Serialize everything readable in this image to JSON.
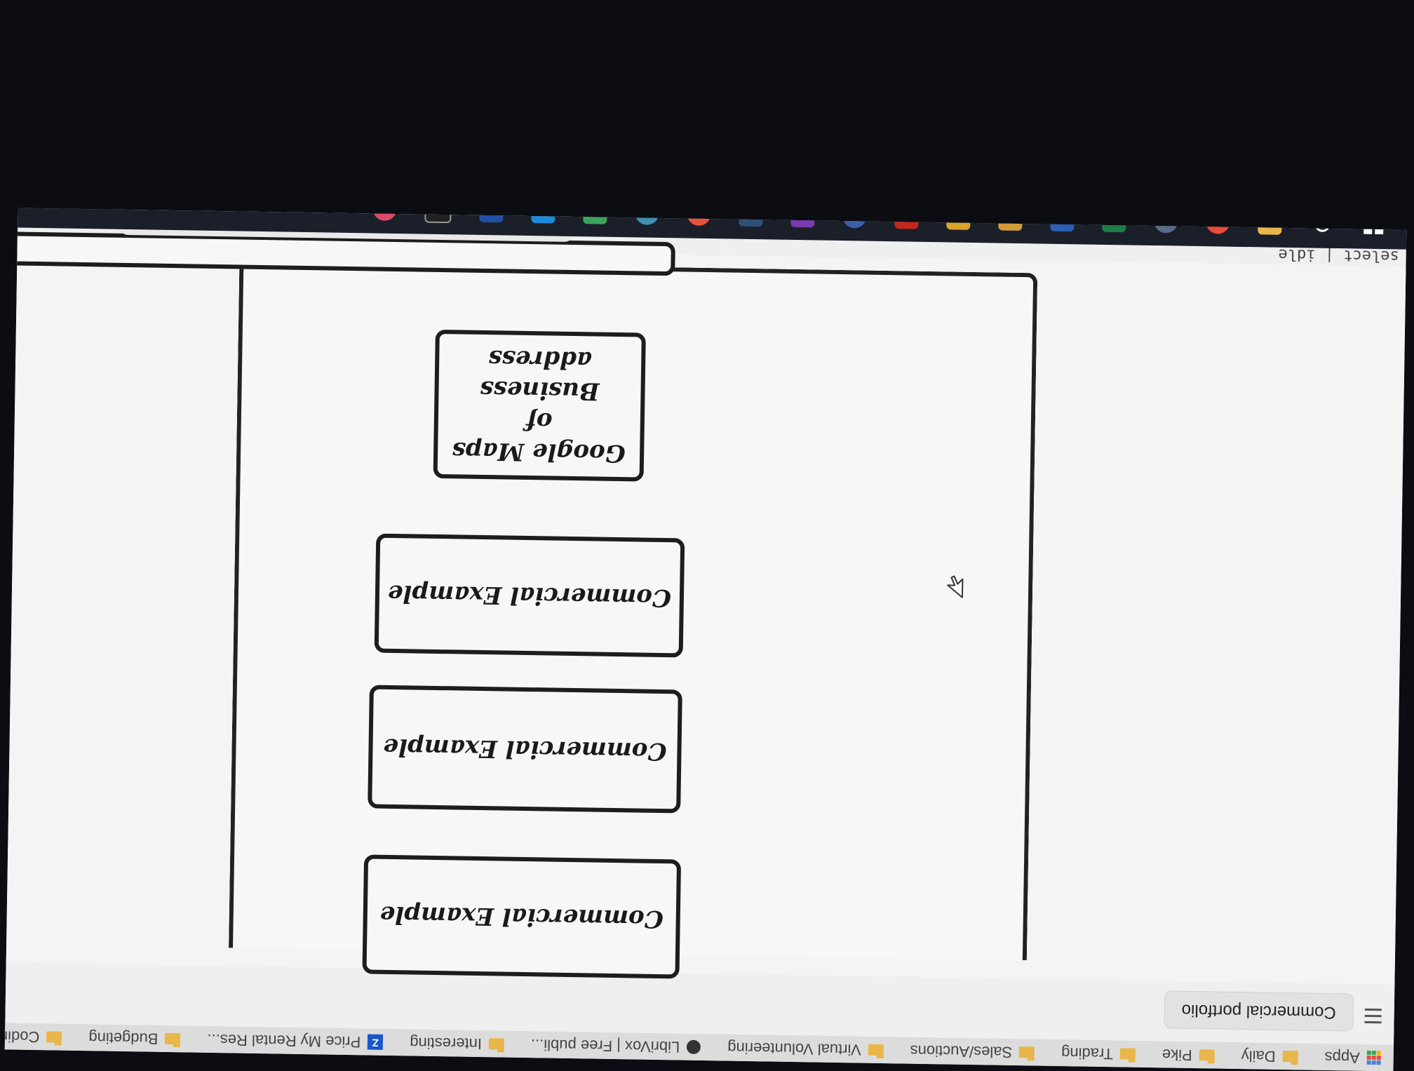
{
  "bookmarks": {
    "items": [
      {
        "label": "Apps",
        "icon": "apps-grid-icon"
      },
      {
        "label": "Daily",
        "icon": "folder-icon"
      },
      {
        "label": "Pike",
        "icon": "folder-icon"
      },
      {
        "label": "Trading",
        "icon": "folder-icon"
      },
      {
        "label": "Sales/Auctions",
        "icon": "folder-icon"
      },
      {
        "label": "Virtual Volunteering",
        "icon": "folder-icon"
      },
      {
        "label": "LibriVox | Free publi...",
        "icon": "librivox-icon"
      },
      {
        "label": "Interesting",
        "icon": "folder-icon"
      },
      {
        "label": "Price My Rental Res...",
        "icon": "zillow-icon"
      },
      {
        "label": "Budgeting",
        "icon": "folder-icon"
      },
      {
        "label": "Coding Jobs",
        "icon": "folder-icon"
      }
    ]
  },
  "header": {
    "title": "Commercial portfolio"
  },
  "canvas": {
    "cards": [
      {
        "text": "Commercial Example"
      },
      {
        "text": "Commercial Example"
      },
      {
        "text": "Commercial Example"
      },
      {
        "line1": "Google Maps of",
        "line2": "Business address"
      }
    ]
  },
  "toolbar": {
    "tools": [
      "select-tool",
      "pencil-tool",
      "eraser-tool",
      "ellipse-tool",
      "arrow-tool",
      "text-tool",
      "sticky-note-tool",
      "delete-tool"
    ],
    "active": "select-tool",
    "more_label": "..."
  },
  "status": {
    "text": "select | idle"
  },
  "colors": {
    "accent": "#2f8ae6",
    "taskbar": "#1b1f2a"
  }
}
